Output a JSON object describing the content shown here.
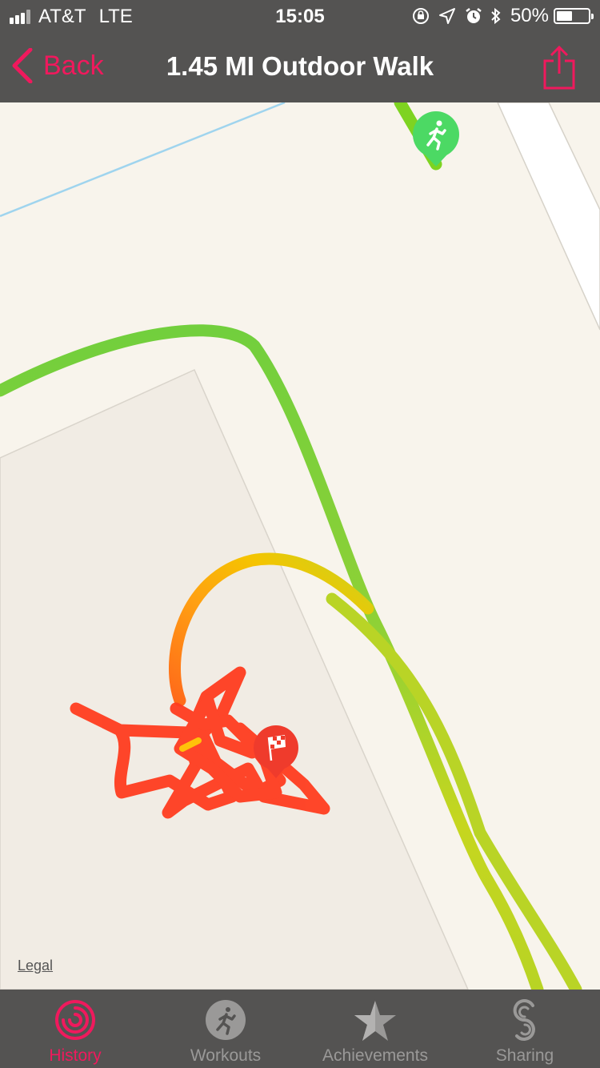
{
  "status_bar": {
    "carrier": "AT&T",
    "network": "LTE",
    "time": "15:05",
    "battery_text": "50%",
    "battery_level": 0.5,
    "icons": [
      "signal-icon",
      "orientation-lock-icon",
      "location-arrow-icon",
      "alarm-icon",
      "bluetooth-icon",
      "battery-icon"
    ]
  },
  "nav": {
    "back_label": "Back",
    "title": "1.45 MI Outdoor Walk",
    "share_icon": "share-icon"
  },
  "map": {
    "legal_label": "Legal",
    "start_marker_icon": "runner-icon",
    "end_marker_icon": "checkered-flag-icon"
  },
  "tabs": [
    {
      "label": "History",
      "icon": "history-rings-icon",
      "active": true
    },
    {
      "label": "Workouts",
      "icon": "runner-icon",
      "active": false
    },
    {
      "label": "Achievements",
      "icon": "star-award-icon",
      "active": false
    },
    {
      "label": "Sharing",
      "icon": "sharing-icon",
      "active": false
    }
  ],
  "colors": {
    "accent": "#f0195d",
    "bar": "#545352",
    "route_fast": "#7ed321",
    "route_mid": "#f5c400",
    "route_slow": "#ff3d1f",
    "start_marker": "#4cd964",
    "end_marker": "#ef3b2c"
  }
}
